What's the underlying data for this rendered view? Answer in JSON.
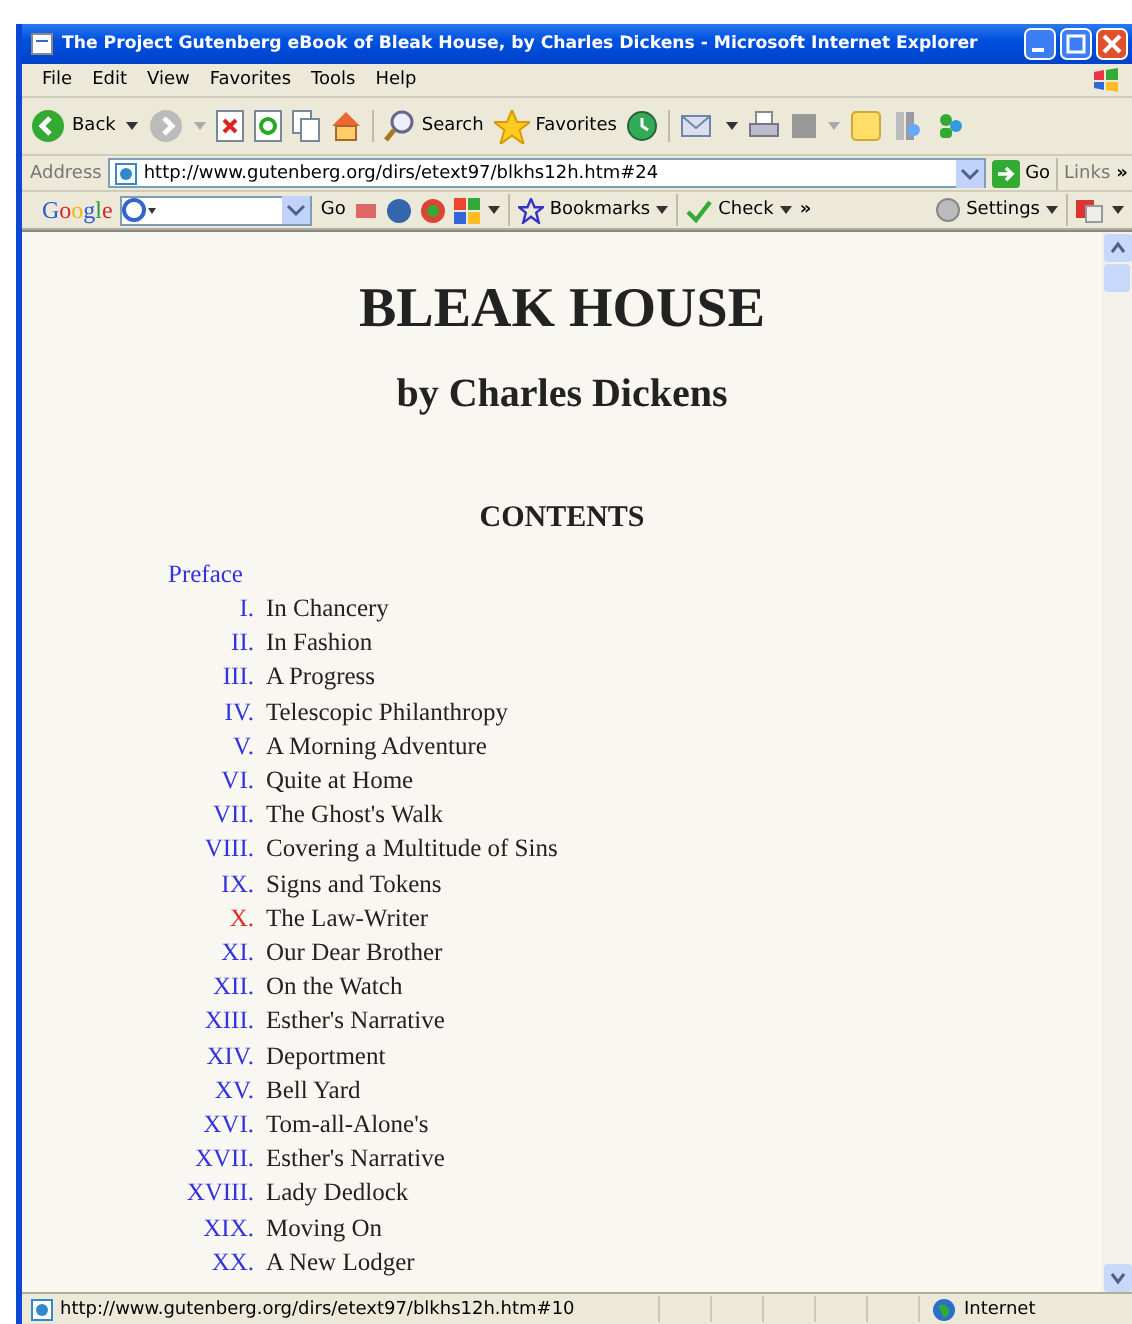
{
  "window": {
    "title": "The Project Gutenberg eBook of Bleak House, by Charles Dickens - Microsoft Internet Explorer"
  },
  "menu": [
    "File",
    "Edit",
    "View",
    "Favorites",
    "Tools",
    "Help"
  ],
  "toolbar": {
    "back": "Back",
    "search": "Search",
    "favorites": "Favorites"
  },
  "address_bar": {
    "label": "Address",
    "value": "http://www.gutenberg.org/dirs/etext97/blkhs12h.htm#24",
    "go": "Go",
    "links": "Links",
    "more": "»"
  },
  "google_bar": {
    "logo": "Google",
    "go": "Go",
    "bookmarks": "Bookmarks",
    "check": "Check",
    "more": "»",
    "settings": "Settings"
  },
  "page": {
    "title": "BLEAK HOUSE",
    "author": "by Charles Dickens",
    "heading": "CONTENTS",
    "preface": "Preface",
    "chapters": [
      {
        "numeral": "I.",
        "title": "In Chancery",
        "active": false
      },
      {
        "numeral": "II.",
        "title": "In Fashion",
        "active": false
      },
      {
        "numeral": "III.",
        "title": "A Progress",
        "active": false
      },
      {
        "numeral": "IV.",
        "title": "Telescopic Philanthropy",
        "active": false
      },
      {
        "numeral": "V.",
        "title": "A Morning Adventure",
        "active": false
      },
      {
        "numeral": "VI.",
        "title": "Quite at Home",
        "active": false
      },
      {
        "numeral": "VII.",
        "title": "The Ghost's Walk",
        "active": false
      },
      {
        "numeral": "VIII.",
        "title": "Covering a Multitude of Sins",
        "active": false
      },
      {
        "numeral": "IX.",
        "title": "Signs and Tokens",
        "active": false
      },
      {
        "numeral": "X.",
        "title": "The Law-Writer",
        "active": true
      },
      {
        "numeral": "XI.",
        "title": "Our Dear Brother",
        "active": false
      },
      {
        "numeral": "XII.",
        "title": "On the Watch",
        "active": false
      },
      {
        "numeral": "XIII.",
        "title": "Esther's Narrative",
        "active": false
      },
      {
        "numeral": "XIV.",
        "title": "Deportment",
        "active": false
      },
      {
        "numeral": "XV.",
        "title": "Bell Yard",
        "active": false
      },
      {
        "numeral": "XVI.",
        "title": "Tom-all-Alone's",
        "active": false
      },
      {
        "numeral": "XVII.",
        "title": "Esther's Narrative",
        "active": false
      },
      {
        "numeral": "XVIII.",
        "title": "Lady Dedlock",
        "active": false
      },
      {
        "numeral": "XIX.",
        "title": "Moving On",
        "active": false
      },
      {
        "numeral": "XX.",
        "title": "A New Lodger",
        "active": false
      }
    ]
  },
  "status_bar": {
    "url": "http://www.gutenberg.org/dirs/etext97/blkhs12h.htm#10",
    "zone": "Internet"
  }
}
